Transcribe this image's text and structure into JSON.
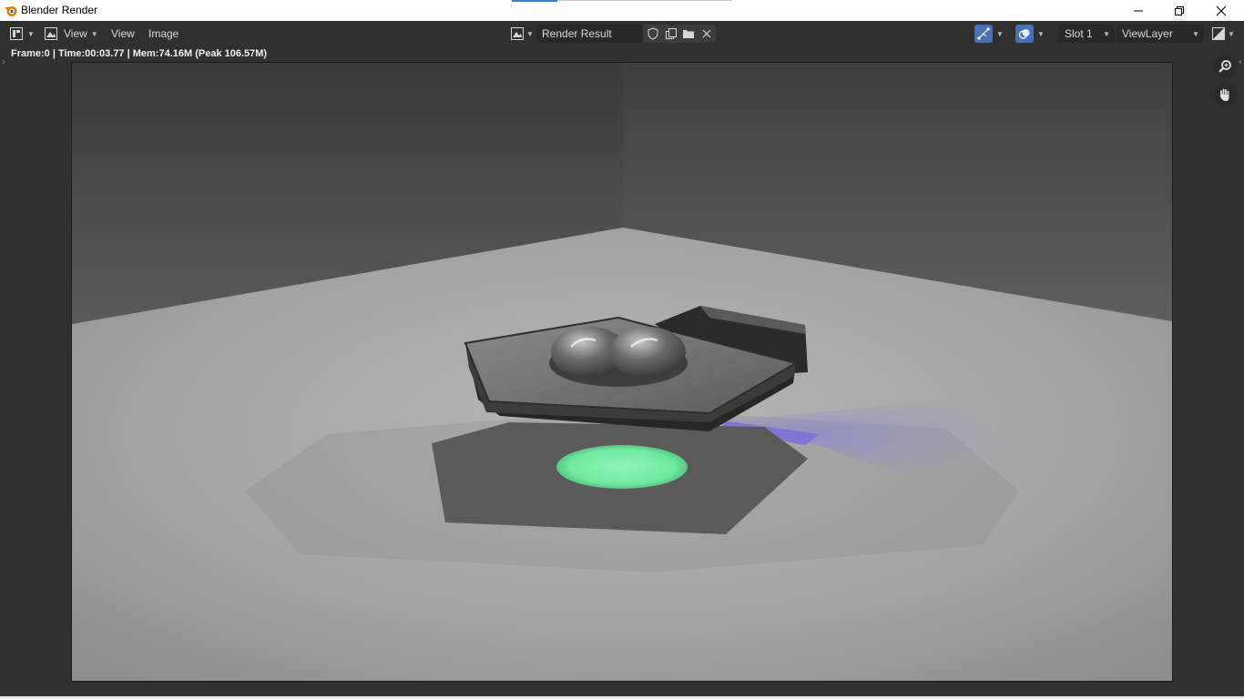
{
  "window": {
    "title": "Blender Render",
    "controls": [
      "minimize",
      "maximize",
      "close"
    ]
  },
  "header": {
    "editor_type_icon": "image-editor-icon",
    "menus": [
      {
        "label": "View",
        "has_dropdown": true
      },
      {
        "label": "View",
        "has_dropdown": false
      },
      {
        "label": "Image",
        "has_dropdown": false
      }
    ],
    "image_selector": {
      "icon": "image-browse-icon",
      "name": "Render Result",
      "actions": [
        "fake-user-shield-icon",
        "duplicate-image-icon",
        "open-folder-icon",
        "unlink-x-icon"
      ]
    },
    "right": {
      "gizmo_icon": "gizmo-icon",
      "overlay_icon": "overlay-icon",
      "slot": "Slot 1",
      "view_layer": "ViewLayer",
      "display_channels_icon": "display-channels-icon"
    }
  },
  "status": {
    "text": "Frame:0 | Time:00:03.77 | Mem:74.16M (Peak 106.57M)"
  },
  "sidebar_tools": [
    "zoom-icon",
    "pan-hand-icon"
  ],
  "colors": {
    "accent_blue": "#4772b3",
    "ui_bg": "#303030",
    "glow_green": "#79f0a8",
    "shadow_purple": "#8276e6"
  }
}
